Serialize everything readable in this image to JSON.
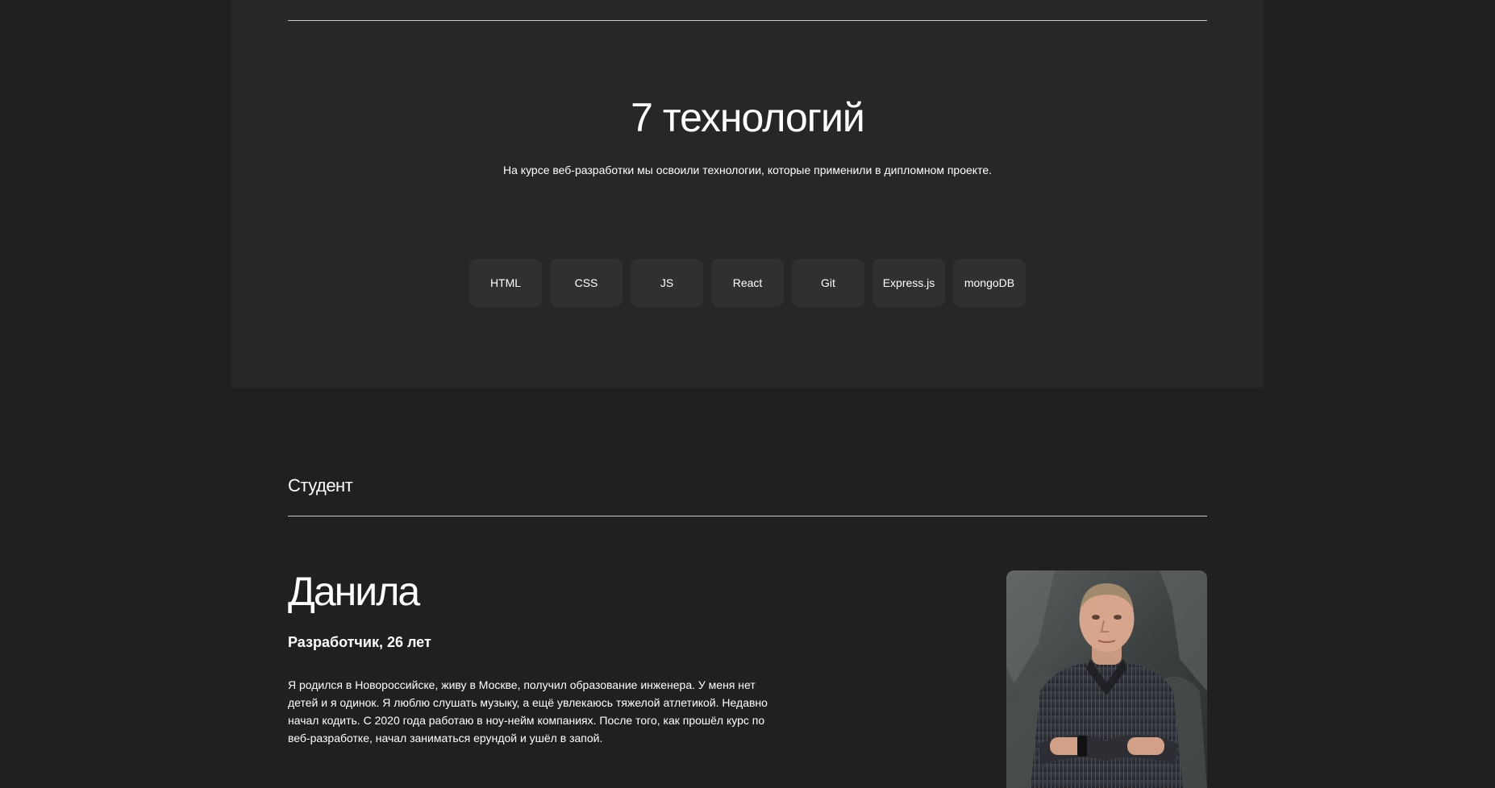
{
  "techs": {
    "title": "7 технологий",
    "subtitle": "На курсе веб-разработки мы освоили технологии, которые применили в дипломном проекте.",
    "items": [
      "HTML",
      "CSS",
      "JS",
      "React",
      "Git",
      "Express.js",
      "mongoDB"
    ]
  },
  "student": {
    "heading": "Студент",
    "name": "Данила",
    "job": "Разработчик, 26 лет",
    "bio": "Я родился в Новороссийске, живу в Москве, получил образование инженера. У меня нет детей и я одинок. Я люблю слушать музыку, а ещё увлекаюсь тяжелой атлетикой. Недавно начал кодить. С 2020 года работаю в ноу-нейм компаниях. После того, как прошёл курс по веб-разработке, начал заниматься ерундой и ушёл в запой."
  },
  "colors": {
    "page_background": "#202020",
    "section_background": "#272727",
    "badge_background": "#303030",
    "text": "#ffffff",
    "rule": "#c8c8c8"
  }
}
